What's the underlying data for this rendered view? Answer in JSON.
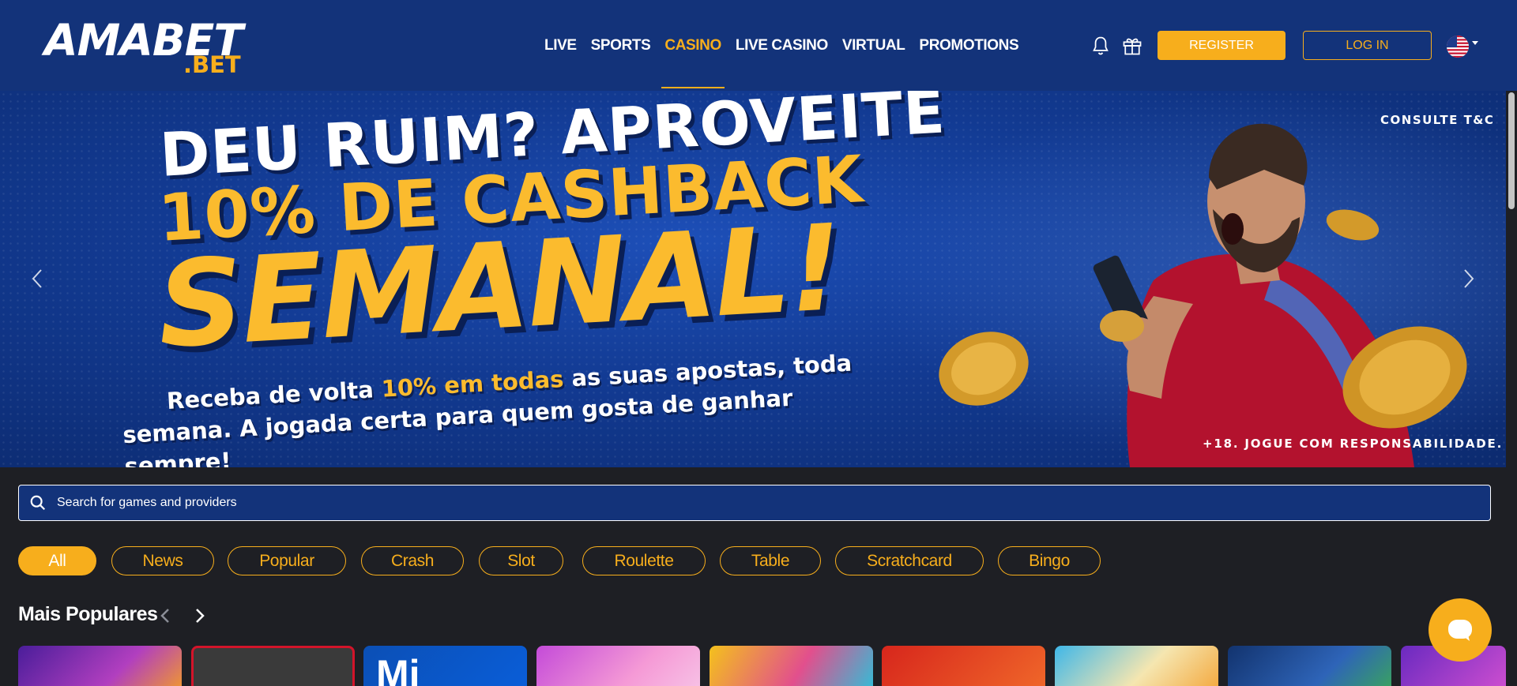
{
  "header": {
    "logo_main": "AMABET",
    "logo_sub": ".BET",
    "nav": [
      {
        "label": "LIVE",
        "active": false
      },
      {
        "label": "SPORTS",
        "active": false
      },
      {
        "label": "CASINO",
        "active": true
      },
      {
        "label": "LIVE CASINO",
        "active": false
      },
      {
        "label": "VIRTUAL",
        "active": false
      },
      {
        "label": "PROMOTIONS",
        "active": false
      }
    ],
    "icons": [
      "bell-icon",
      "gift-icon"
    ],
    "register_label": "REGISTER",
    "login_label": "LOG IN",
    "language_flag": "us-flag-icon"
  },
  "banner": {
    "headline_1": "DEU RUIM? APROVEITE",
    "headline_2": "10% DE CASHBACK",
    "headline_3": "SEMANAL!",
    "subtext_a": "Receba de volta ",
    "subtext_highlight": "10% em todas",
    "subtext_b": " as suas apostas, toda",
    "subtext_line2": "semana. A jogada certa para quem gosta de ganhar sempre!",
    "terms": "CONSULTE T&C",
    "responsible": "+18. JOGUE COM RESPONSABILIDADE."
  },
  "search": {
    "placeholder": "Search for games and providers",
    "value": ""
  },
  "categories": [
    {
      "label": "All",
      "active": true
    },
    {
      "label": "News",
      "active": false
    },
    {
      "label": "Popular",
      "active": false
    },
    {
      "label": "Crash",
      "active": false
    },
    {
      "label": "Slot",
      "active": false
    },
    {
      "label": "Roulette",
      "active": false
    },
    {
      "label": "Table",
      "active": false
    },
    {
      "label": "Scratchcard",
      "active": false
    },
    {
      "label": "Bingo",
      "active": false
    }
  ],
  "section": {
    "title": "Mais Populares"
  },
  "tiles": [
    {
      "label": ""
    },
    {
      "label": ""
    },
    {
      "label": "Mi"
    },
    {
      "label": ""
    },
    {
      "label": ""
    },
    {
      "label": ""
    },
    {
      "label": ""
    },
    {
      "label": ""
    },
    {
      "label": ""
    }
  ],
  "colors": {
    "header_bg": "#13337a",
    "accent": "#f7ae1c",
    "page_bg": "#1e1f24"
  }
}
